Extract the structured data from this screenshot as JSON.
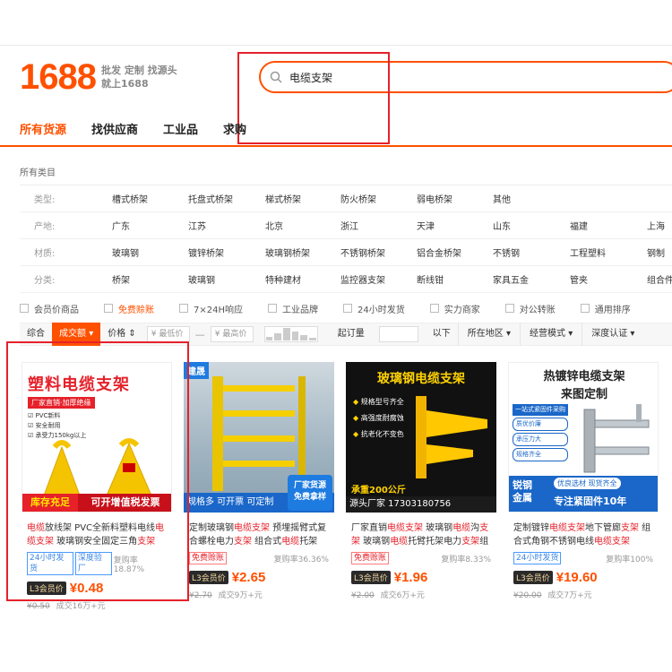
{
  "header": {
    "logo_num": "1688",
    "logo_tag_1": "批发 定制 找源头",
    "logo_tag_2": "就上1688",
    "search_query": "电缆支架"
  },
  "tabs": [
    "所有货源",
    "找供应商",
    "工业品",
    "求购"
  ],
  "breadcrumb": "所有类目",
  "filters": [
    {
      "label": "类型:",
      "options": [
        "槽式桥架",
        "托盘式桥架",
        "梯式桥架",
        "防火桥架",
        "弱电桥架",
        "其他"
      ]
    },
    {
      "label": "产地:",
      "options": [
        "广东",
        "江苏",
        "北京",
        "浙江",
        "天津",
        "山东",
        "福建",
        "上海"
      ]
    },
    {
      "label": "材质:",
      "options": [
        "玻璃钢",
        "镀锌桥架",
        "玻璃钢桥架",
        "不锈钢桥架",
        "铝合金桥架",
        "不锈钢",
        "工程塑料",
        "钢制"
      ]
    },
    {
      "label": "分类:",
      "options": [
        "桥架",
        "玻璃钢",
        "特种建材",
        "监控器支架",
        "断线钳",
        "家具五金",
        "管夹",
        "组合件"
      ]
    }
  ],
  "checks": [
    "会员价商品",
    "免费赊账",
    "7×24H响应",
    "工业品牌",
    "24小时发货",
    "实力商家",
    "对公转账",
    "通用排序"
  ],
  "sortbar": {
    "default": "综合",
    "volume": "成交额",
    "price": "价格",
    "min_price": "¥ 最低价",
    "max_price": "¥ 最高价",
    "moq": "起订量",
    "below": "以下",
    "location": "所在地区",
    "mode": "经营模式",
    "cert": "深度认证"
  },
  "products": [
    {
      "img": {
        "headline": "塑料电缆支架",
        "sub": "厂家直销·加厚绝缘",
        "bullets": [
          "PVC新料",
          "安全耐用",
          "承受力150kg以上"
        ],
        "banner_left": "库存充足",
        "banner_right": "可开增值税发票"
      },
      "title_parts": [
        [
          "电缆",
          true
        ],
        [
          "放线架 PVC全新料塑料电线",
          false
        ],
        [
          "电缆",
          true
        ],
        [
          "支架",
          true
        ],
        [
          " 玻璃钢安全固定三角",
          false
        ],
        [
          "支架",
          true
        ]
      ],
      "tags": [
        [
          "24小时发货",
          false
        ],
        [
          "深度验厂",
          false
        ]
      ],
      "repurchase": "复购率18.87%",
      "price": "¥0.48",
      "old_price": "¥0.50",
      "sold": "成交16万+元"
    },
    {
      "img": {
        "corner": "建晟",
        "banner": "规格多 可开票 可定制",
        "badge": "厂家货源\n免费拿样"
      },
      "title_parts": [
        [
          "定制玻璃钢",
          false
        ],
        [
          "电缆支架",
          true
        ],
        [
          " 预埋摇臂式复合螺栓电力",
          false
        ],
        [
          "支架",
          true
        ],
        [
          " 组合式",
          false
        ],
        [
          "电缆",
          true
        ],
        [
          "托架",
          false
        ]
      ],
      "tags": [
        [
          "免费赊账",
          true
        ]
      ],
      "repurchase": "复购率36.36%",
      "price": "¥2.65",
      "old_price": "¥2.70",
      "sold": "成交9万+元"
    },
    {
      "img": {
        "headline": "玻璃钢电缆支架",
        "bullets": [
          "规格型号齐全",
          "高强度耐腐蚀",
          "抗老化不变色"
        ],
        "load": "承重200公斤",
        "bottom": "源头厂家  17303180756"
      },
      "title_parts": [
        [
          "厂家直销",
          false
        ],
        [
          "电缆支架",
          true
        ],
        [
          " 玻璃钢",
          false
        ],
        [
          "电缆",
          true
        ],
        [
          "沟",
          false
        ],
        [
          "支架",
          true
        ],
        [
          " 玻璃钢",
          false
        ],
        [
          "电缆",
          true
        ],
        [
          "托臂托架电力",
          false
        ],
        [
          "支架",
          true
        ],
        [
          "组合式",
          false
        ]
      ],
      "tags": [
        [
          "免费赊账",
          true
        ]
      ],
      "repurchase": "复购率8.33%",
      "price": "¥1.96",
      "old_price": "¥2.00",
      "sold": "成交6万+元"
    },
    {
      "img": {
        "headline": "热镀锌电缆支架",
        "sub": "来图定制",
        "pills": [
          "一站式紧固件采购",
          "质优价廉",
          "承压力大",
          "规格齐全"
        ],
        "brand": "锐钢\n金属",
        "b1": "优良选材 现货齐全",
        "b2": "专注紧固件10年"
      },
      "title_parts": [
        [
          "定制镀锌",
          false
        ],
        [
          "电缆支架",
          true
        ],
        [
          "地下管廊",
          false
        ],
        [
          "支架",
          true
        ],
        [
          " 组合式角钢不锈钢电线",
          false
        ],
        [
          "电缆",
          true
        ],
        [
          "支架",
          true
        ]
      ],
      "tags": [
        [
          "24小时发货",
          false
        ]
      ],
      "repurchase": "复购率100%",
      "price": "¥19.60",
      "old_price": "¥20.00",
      "sold": "成交7万+元"
    }
  ],
  "vip_label": "L3会员价",
  "colors": {
    "brand": "#ff5000",
    "highlight": "#e6212a",
    "tag_blue": "#3a86e8"
  }
}
